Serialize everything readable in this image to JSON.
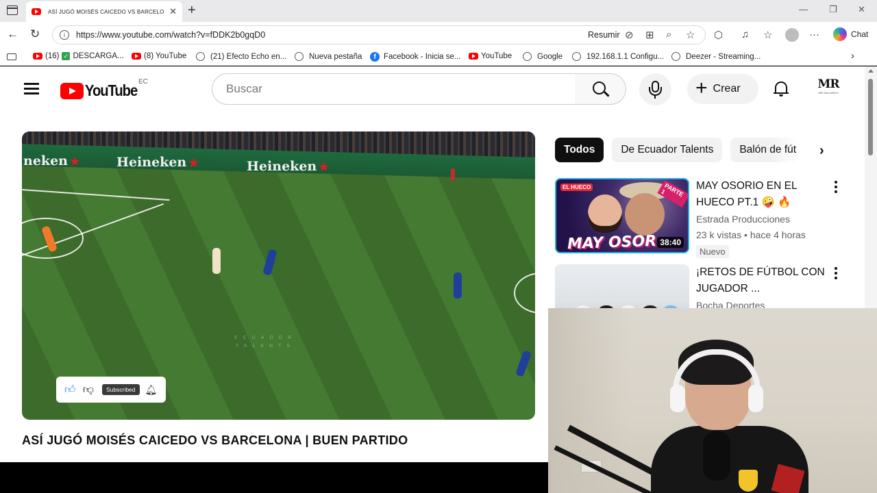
{
  "browser": {
    "tab_title": "ASÍ JUGÓ MOISÉS CAICEDO VS BARCELONA | BUEN PARTIDO",
    "url": "https://www.youtube.com/watch?v=fDDK2b0gqD0",
    "summarize_label": "Resumir",
    "chat_label": "Chat",
    "bookmarks": [
      {
        "label": "(16)",
        "icon": "youtube-icon"
      },
      {
        "label": "DESCARGA...",
        "icon": "check-icon"
      },
      {
        "label": "(8) YouTube",
        "icon": "youtube-icon"
      },
      {
        "label": "(21) Efecto Echo en...",
        "icon": "globe-icon"
      },
      {
        "label": "Nueva pestaña",
        "icon": "globe-icon"
      },
      {
        "label": "Facebook - Inicia se...",
        "icon": "facebook-icon"
      },
      {
        "label": "YouTube",
        "icon": "youtube-icon"
      },
      {
        "label": "Google",
        "icon": "globe-icon"
      },
      {
        "label": "192.168.1.1 Configu...",
        "icon": "globe-icon"
      },
      {
        "label": "Deezer - Streaming...",
        "icon": "globe-icon"
      }
    ]
  },
  "youtube": {
    "logo_text": "YouTube",
    "country_code": "EC",
    "search_placeholder": "Buscar",
    "create_label": "Crear",
    "account_initials": "MR",
    "account_sub": "MR GALLARDO",
    "video": {
      "title": "ASÍ JUGÓ MOISÉS CAICEDO VS BARCELONA | BUEN PARTIDO",
      "ad_boards": [
        "neken",
        "Heineken",
        "Heineken"
      ],
      "watermark_line1": "ECUADOR",
      "watermark_line2": "TALENTS",
      "subscribed_label": "Subscribed"
    },
    "chips": [
      "Todos",
      "De Ecuador Talents",
      "Balón de fút"
    ],
    "recommendations": [
      {
        "title": "MAY OSORIO EN EL HUECO PT.1 🤪 🔥",
        "channel": "Estrada Producciones",
        "views": "23 k vistas",
        "age": "hace 4 horas",
        "badge": "Nuevo",
        "duration": "38:40",
        "thumb_text": "MAY OSOR",
        "thumb_tag": "PARTE 1",
        "thumb_logo": "EL HUECO"
      },
      {
        "title": "¡RETOS DE FÚTBOL CON JUGADOR ...",
        "channel": "Bocha Deportes"
      }
    ]
  },
  "colors": {
    "youtube_red": "#ff0000",
    "pitch_green": "#457a32",
    "thumb_border": "#20b0e6"
  }
}
